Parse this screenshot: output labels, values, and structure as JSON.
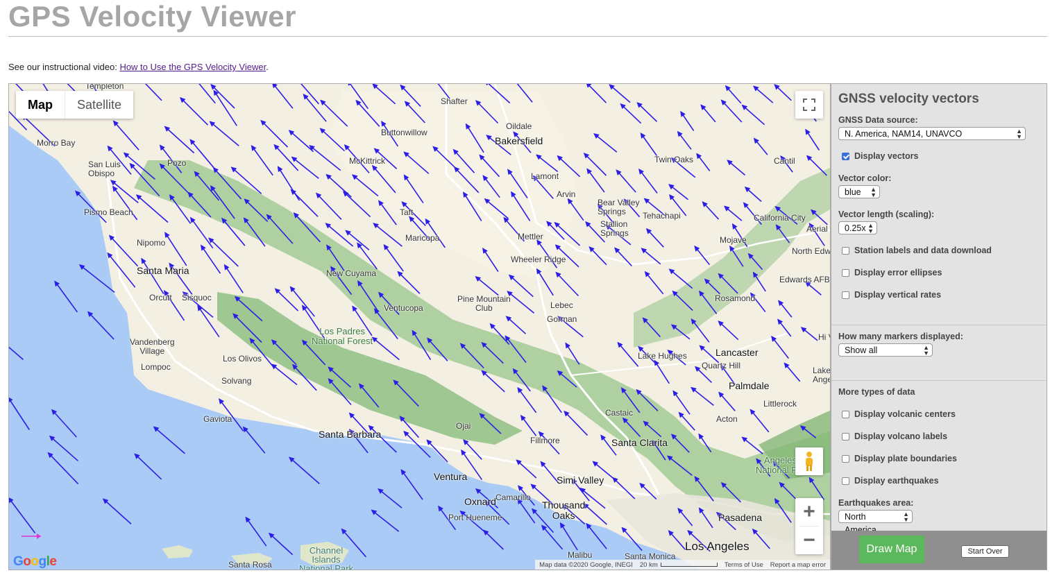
{
  "page": {
    "title": "GPS Velocity Viewer",
    "intro_text": "See our instructional video: ",
    "intro_link": "How to Use the GPS Velocity Viewer",
    "intro_end": "."
  },
  "map": {
    "type_buttons": [
      "Map",
      "Satellite"
    ],
    "google_logo": "Google",
    "attribution": {
      "data": "Map data ©2020 Google, INEGI",
      "scale": "20 km",
      "terms": "Terms of Use",
      "report": "Report a map error"
    },
    "labels": {
      "templeton": "Templeton",
      "shafter": "Shafter",
      "oildale": "Oildale",
      "buttonwillow": "Buttonwillow",
      "bakersfield": "Bakersfield",
      "morro_bay": "Morro Bay",
      "san_luis_obispo": "San Luis\nObispo",
      "pozo": "Pozo",
      "mckittrick": "McKittrick",
      "lamont": "Lamont",
      "arvin": "Arvin",
      "twin_oaks": "Twin Oaks",
      "cantil": "Cantil",
      "pismo_beach": "Pismo Beach",
      "taft": "Taft",
      "bear_valley_springs": "Bear Valley\nSprings",
      "tehachapi": "Tehachapi",
      "stallion_springs": "Stallion\nSprings",
      "california_city": "California City",
      "aerial": "Aerial",
      "nipomo": "Nipomo",
      "maricopa": "Maricopa",
      "mettler": "Mettler",
      "mojave": "Mojave",
      "north_edw": "North Edw",
      "santa_maria": "Santa Maria",
      "new_cuyama": "New Cuyama",
      "wheeler_ridge": "Wheeler Ridge",
      "edwards_afb": "Edwards AFB",
      "orcutt": "Orcutt",
      "sisquoc": "Sisquoc",
      "ventucopa": "Ventucopa",
      "pine_mountain_club": "Pine Mountain\nClub",
      "lebec": "Lebec",
      "rosamond": "Rosamond",
      "gorman": "Gorman",
      "los_padres": "Los Padres\nNational Forest",
      "hi_v": "Hi V",
      "vandenberg": "Vandenberg\nVillage",
      "lompoc": "Lompoc",
      "los_olivos": "Los Olivos",
      "lancaster": "Lancaster",
      "lake_hughes": "Lake Hughes",
      "quartz_hill": "Quartz Hill",
      "lake_los_angeles": "Lake Lo\nAngele",
      "solvang": "Solvang",
      "palmdale": "Palmdale",
      "littlerock": "Littlerock",
      "gaviota": "Gaviota",
      "castaic": "Castaic",
      "acton": "Acton",
      "santa_barbara": "Santa Barbara",
      "ojai": "Ojai",
      "fillmore": "Fillmore",
      "santa_clarita": "Santa Clarita",
      "angeles_nf": "Angeles\nNational For",
      "ventura": "Ventura",
      "simi_valley": "Simi Valley",
      "oxnard": "Oxnard",
      "camarillo": "Camarillo",
      "thousand_oaks": "Thousand\nOaks",
      "pasadena": "Pasadena",
      "port_hueneme": "Port Hueneme",
      "malibu": "Malibu",
      "santa_monica": "Santa Monica",
      "los_angeles": "Los Angeles",
      "channel_islands": "Channel\nIslands\nNational Park",
      "santa_rosa": "Santa Rosa"
    }
  },
  "panel": {
    "title": "GNSS velocity vectors",
    "data_source_label": "GNSS Data source:",
    "data_source_value": "N. America, NAM14, UNAVCO",
    "display_vectors_label": "Display vectors",
    "display_vectors_checked": true,
    "vector_color_label": "Vector color:",
    "vector_color_value": "blue",
    "vector_length_label": "Vector length (scaling):",
    "vector_length_value": "0.25x",
    "station_labels_label": "Station labels and data download",
    "error_ellipses_label": "Display error ellipses",
    "vertical_rates_label": "Display vertical rates",
    "markers_label": "How many markers displayed:",
    "markers_value": "Show all",
    "more_types_label": "More types of data",
    "volcanic_centers_label": "Display volcanic centers",
    "volcano_labels_label": "Display volcano labels",
    "plate_boundaries_label": "Display plate boundaries",
    "earthquakes_label": "Display earthquakes",
    "eq_area_label": "Earthquakes area:",
    "eq_area_value": "North America",
    "draw_button": "Draw Map",
    "start_over_button": "Start Over"
  },
  "colors": {
    "vector": "#2d1ee6",
    "reference_arrow": "#e033d0",
    "ocean": "#a9cbf5",
    "land": "#f3f0e3",
    "forest": "#9dc88f"
  }
}
